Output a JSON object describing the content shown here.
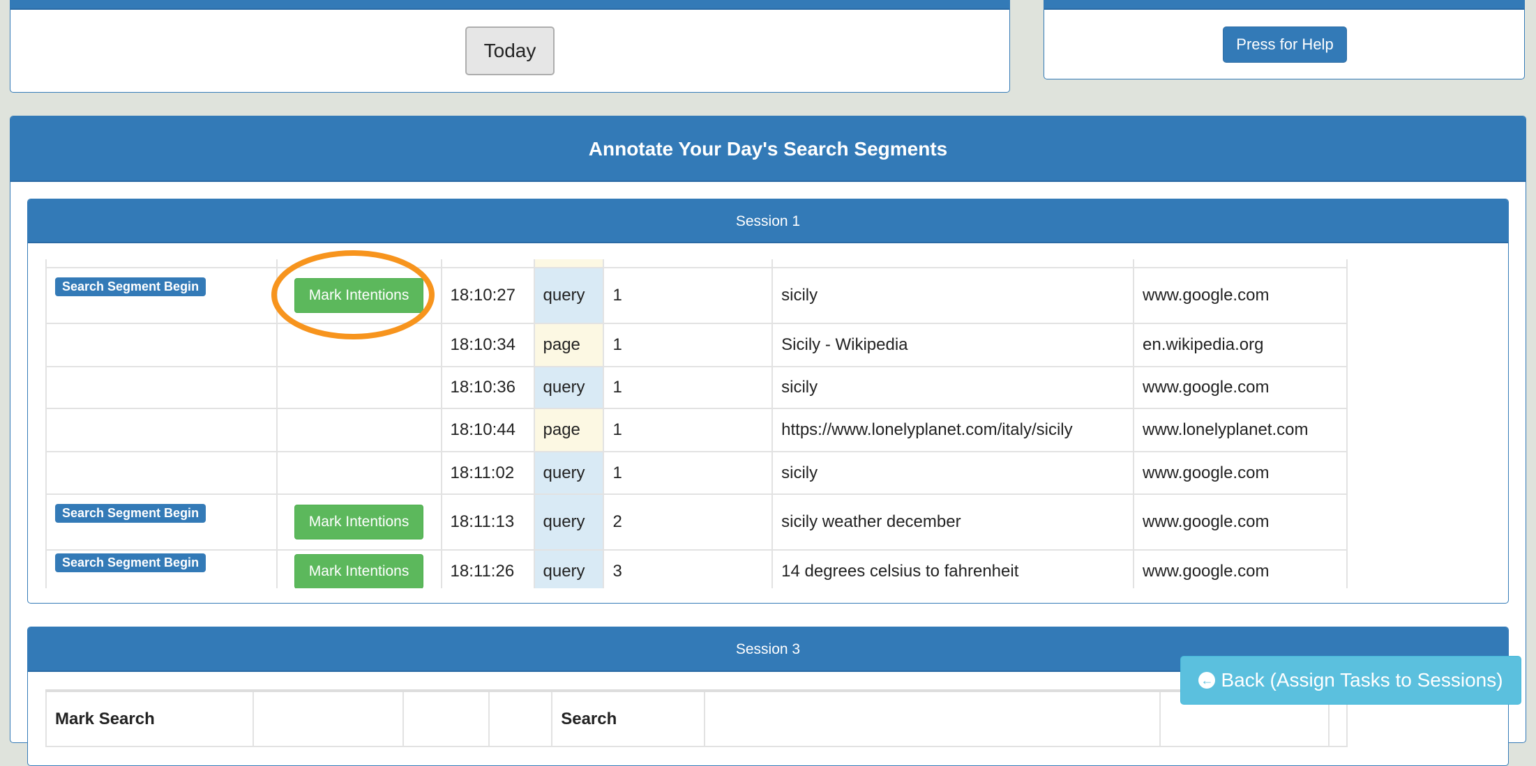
{
  "top": {
    "today_label": "Today",
    "help_label": "Press for Help"
  },
  "main": {
    "title": "Annotate Your Day's Search Segments"
  },
  "session1": {
    "title": "Session 1",
    "badge_label": "Search Segment Begin",
    "mark_label": "Mark Intentions",
    "rows": [
      {
        "segment": true,
        "time": "18:10:27",
        "type": "query",
        "num": "1",
        "title": "sicily",
        "domain": "www.google.com"
      },
      {
        "segment": false,
        "time": "18:10:34",
        "type": "page",
        "num": "1",
        "title": "Sicily - Wikipedia",
        "domain": "en.wikipedia.org"
      },
      {
        "segment": false,
        "time": "18:10:36",
        "type": "query",
        "num": "1",
        "title": "sicily",
        "domain": "www.google.com"
      },
      {
        "segment": false,
        "time": "18:10:44",
        "type": "page",
        "num": "1",
        "title": "https://www.lonelyplanet.com/italy/sicily",
        "domain": "www.lonelyplanet.com"
      },
      {
        "segment": false,
        "time": "18:11:02",
        "type": "query",
        "num": "1",
        "title": "sicily",
        "domain": "www.google.com"
      },
      {
        "segment": true,
        "time": "18:11:13",
        "type": "query",
        "num": "2",
        "title": "sicily weather december",
        "domain": "www.google.com"
      },
      {
        "segment": true,
        "time": "18:11:26",
        "type": "query",
        "num": "3",
        "title": "14 degrees celsius to fahrenheit",
        "domain": "www.google.com"
      }
    ]
  },
  "session3": {
    "title": "Session 3",
    "headers": [
      "Mark Search",
      "",
      "",
      "",
      "Search",
      "",
      "",
      ""
    ]
  },
  "back_label": "Back (Assign Tasks to Sessions)",
  "colors": {
    "primary": "#337ab7",
    "success": "#5cb85c",
    "info": "#5bc0de",
    "highlight": "#f7941d"
  }
}
